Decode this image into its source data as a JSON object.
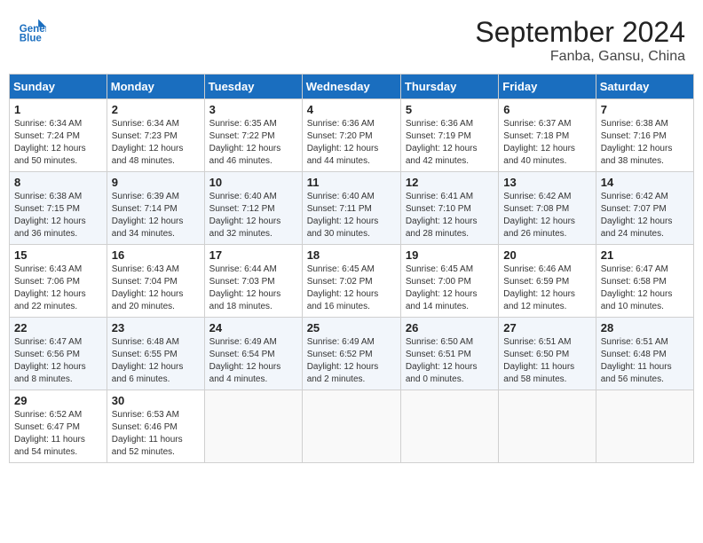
{
  "header": {
    "logo_line1": "General",
    "logo_line2": "Blue",
    "month": "September 2024",
    "location": "Fanba, Gansu, China"
  },
  "weekdays": [
    "Sunday",
    "Monday",
    "Tuesday",
    "Wednesday",
    "Thursday",
    "Friday",
    "Saturday"
  ],
  "weeks": [
    [
      {
        "day": "1",
        "info": "Sunrise: 6:34 AM\nSunset: 7:24 PM\nDaylight: 12 hours\nand 50 minutes."
      },
      {
        "day": "2",
        "info": "Sunrise: 6:34 AM\nSunset: 7:23 PM\nDaylight: 12 hours\nand 48 minutes."
      },
      {
        "day": "3",
        "info": "Sunrise: 6:35 AM\nSunset: 7:22 PM\nDaylight: 12 hours\nand 46 minutes."
      },
      {
        "day": "4",
        "info": "Sunrise: 6:36 AM\nSunset: 7:20 PM\nDaylight: 12 hours\nand 44 minutes."
      },
      {
        "day": "5",
        "info": "Sunrise: 6:36 AM\nSunset: 7:19 PM\nDaylight: 12 hours\nand 42 minutes."
      },
      {
        "day": "6",
        "info": "Sunrise: 6:37 AM\nSunset: 7:18 PM\nDaylight: 12 hours\nand 40 minutes."
      },
      {
        "day": "7",
        "info": "Sunrise: 6:38 AM\nSunset: 7:16 PM\nDaylight: 12 hours\nand 38 minutes."
      }
    ],
    [
      {
        "day": "8",
        "info": "Sunrise: 6:38 AM\nSunset: 7:15 PM\nDaylight: 12 hours\nand 36 minutes."
      },
      {
        "day": "9",
        "info": "Sunrise: 6:39 AM\nSunset: 7:14 PM\nDaylight: 12 hours\nand 34 minutes."
      },
      {
        "day": "10",
        "info": "Sunrise: 6:40 AM\nSunset: 7:12 PM\nDaylight: 12 hours\nand 32 minutes."
      },
      {
        "day": "11",
        "info": "Sunrise: 6:40 AM\nSunset: 7:11 PM\nDaylight: 12 hours\nand 30 minutes."
      },
      {
        "day": "12",
        "info": "Sunrise: 6:41 AM\nSunset: 7:10 PM\nDaylight: 12 hours\nand 28 minutes."
      },
      {
        "day": "13",
        "info": "Sunrise: 6:42 AM\nSunset: 7:08 PM\nDaylight: 12 hours\nand 26 minutes."
      },
      {
        "day": "14",
        "info": "Sunrise: 6:42 AM\nSunset: 7:07 PM\nDaylight: 12 hours\nand 24 minutes."
      }
    ],
    [
      {
        "day": "15",
        "info": "Sunrise: 6:43 AM\nSunset: 7:06 PM\nDaylight: 12 hours\nand 22 minutes."
      },
      {
        "day": "16",
        "info": "Sunrise: 6:43 AM\nSunset: 7:04 PM\nDaylight: 12 hours\nand 20 minutes."
      },
      {
        "day": "17",
        "info": "Sunrise: 6:44 AM\nSunset: 7:03 PM\nDaylight: 12 hours\nand 18 minutes."
      },
      {
        "day": "18",
        "info": "Sunrise: 6:45 AM\nSunset: 7:02 PM\nDaylight: 12 hours\nand 16 minutes."
      },
      {
        "day": "19",
        "info": "Sunrise: 6:45 AM\nSunset: 7:00 PM\nDaylight: 12 hours\nand 14 minutes."
      },
      {
        "day": "20",
        "info": "Sunrise: 6:46 AM\nSunset: 6:59 PM\nDaylight: 12 hours\nand 12 minutes."
      },
      {
        "day": "21",
        "info": "Sunrise: 6:47 AM\nSunset: 6:58 PM\nDaylight: 12 hours\nand 10 minutes."
      }
    ],
    [
      {
        "day": "22",
        "info": "Sunrise: 6:47 AM\nSunset: 6:56 PM\nDaylight: 12 hours\nand 8 minutes."
      },
      {
        "day": "23",
        "info": "Sunrise: 6:48 AM\nSunset: 6:55 PM\nDaylight: 12 hours\nand 6 minutes."
      },
      {
        "day": "24",
        "info": "Sunrise: 6:49 AM\nSunset: 6:54 PM\nDaylight: 12 hours\nand 4 minutes."
      },
      {
        "day": "25",
        "info": "Sunrise: 6:49 AM\nSunset: 6:52 PM\nDaylight: 12 hours\nand 2 minutes."
      },
      {
        "day": "26",
        "info": "Sunrise: 6:50 AM\nSunset: 6:51 PM\nDaylight: 12 hours\nand 0 minutes."
      },
      {
        "day": "27",
        "info": "Sunrise: 6:51 AM\nSunset: 6:50 PM\nDaylight: 11 hours\nand 58 minutes."
      },
      {
        "day": "28",
        "info": "Sunrise: 6:51 AM\nSunset: 6:48 PM\nDaylight: 11 hours\nand 56 minutes."
      }
    ],
    [
      {
        "day": "29",
        "info": "Sunrise: 6:52 AM\nSunset: 6:47 PM\nDaylight: 11 hours\nand 54 minutes."
      },
      {
        "day": "30",
        "info": "Sunrise: 6:53 AM\nSunset: 6:46 PM\nDaylight: 11 hours\nand 52 minutes."
      },
      null,
      null,
      null,
      null,
      null
    ]
  ]
}
